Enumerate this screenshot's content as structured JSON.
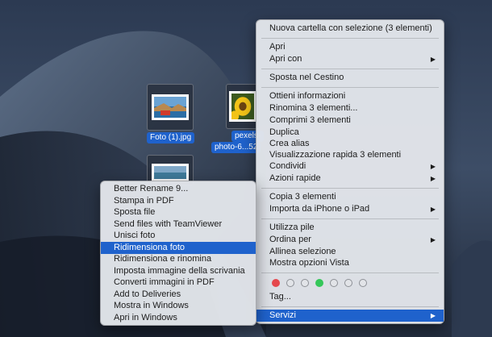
{
  "desktop": {
    "files": [
      {
        "name": "Foto (1).jpg"
      },
      {
        "name_line1": "pexels-",
        "name_line2": "photo-6...52"
      }
    ]
  },
  "context_menu": {
    "new_folder": "Nuova cartella con selezione (3 elementi)",
    "open": "Apri",
    "open_with": "Apri con",
    "move_to_trash": "Sposta nel Cestino",
    "get_info": "Ottieni informazioni",
    "rename": "Rinomina 3 elementi...",
    "compress": "Comprimi 3 elementi",
    "duplicate": "Duplica",
    "make_alias": "Crea alias",
    "quick_look": "Visualizzazione rapida 3 elementi",
    "share": "Condividi",
    "quick_actions": "Azioni rapide",
    "copy": "Copia 3 elementi",
    "import": "Importa da iPhone o iPad",
    "use_stacks": "Utilizza pile",
    "sort_by": "Ordina per",
    "align": "Allinea selezione",
    "view_options": "Mostra opzioni Vista",
    "tags": "Tag...",
    "services": "Servizi",
    "arrow_glyph": "▶"
  },
  "tag_colors": [
    "#e5484d",
    "#e2e4e8",
    "#e2e4e8",
    "#35c759",
    "#e2e4e8",
    "#e2e4e8",
    "#e2e4e8"
  ],
  "services_menu": {
    "items": [
      "Better Rename 9...",
      "Stampa in PDF",
      "Sposta file",
      "Send files with TeamViewer",
      "Unisci foto",
      "Ridimensiona foto",
      "Ridimensiona e rinomina",
      "Imposta immagine della scrivania",
      "Converti immagini in PDF",
      "Add to Deliveries",
      "Mostra in Windows",
      "Apri in Windows"
    ],
    "highlighted_index": 5
  },
  "colors": {
    "highlight": "#1f62cc"
  }
}
